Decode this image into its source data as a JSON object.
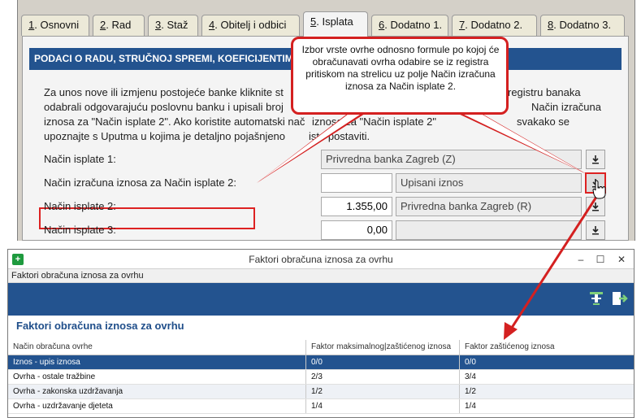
{
  "form": {
    "tabs": [
      {
        "num": "1",
        "label": ". Osnovni"
      },
      {
        "num": "2",
        "label": ". Rad"
      },
      {
        "num": "3",
        "label": ". Staž"
      },
      {
        "num": "4",
        "label": ". Obitelj i odbici"
      },
      {
        "num": "5",
        "label": ". Isplata"
      },
      {
        "num": "6",
        "label": ". Dodatno 1."
      },
      {
        "num": "7",
        "label": ". Dodatno 2."
      },
      {
        "num": "8",
        "label": ". Dodatno 3."
      }
    ],
    "active_tab": "5. Isplata",
    "section_header": "PODACI O RADU, STRUČNOJ SPREMI, KOEFICIJENTIMA, IS",
    "intro_lines": [
      "Za unos nove ili izmjenu postojeće banke kliknite st",
      "odabrali odgovarajuću poslovnu banku i upisali broj",
      "iznosa za \"Način isplate 2\". Ako koristite automatski nač",
      "upoznajte s Uputma u kojima je detaljno pojašnjeno",
      "registru banaka",
      "Način izračuna",
      "iznosa za \"Način isplate 2\"",
      "svakako se",
      "isto postaviti."
    ],
    "rows": [
      {
        "label": "Način isplate 1:",
        "amount": "",
        "bank": "Privredna banka Zagreb (Z)"
      },
      {
        "label": "Način izračuna iznosa za Način isplate 2:",
        "amount": "",
        "bank": "Upisani iznos"
      },
      {
        "label": "Način isplate 2:",
        "amount": "1.355,00",
        "bank": "Privredna banka Zagreb (R)"
      },
      {
        "label": "Način isplate 3:",
        "amount": "0,00",
        "bank": ""
      }
    ]
  },
  "callout": {
    "text": "Izbor vrste ovrhe odnosno formule po kojoj će obračunavati ovrha odabire se iz registra pritiskom na strelicu uz polje Način izračuna iznosa za Način isplate 2."
  },
  "dialog": {
    "title": "Faktori obračuna iznosa za ovrhu",
    "subtitle": "Faktori obračuna iznosa za ovrhu",
    "section_title": "Faktori obračuna iznosa za ovrhu",
    "window_controls": {
      "minimize": "–",
      "maximize": "☐",
      "close": "✕"
    },
    "columns": [
      "Način obračuna ovrhe",
      "Faktor maksimalnog|zaštićenog iznosa",
      "Faktor zaštićenog iznosa"
    ],
    "rows": [
      [
        "Iznos - upis iznosa",
        "0/0",
        "0/0"
      ],
      [
        "Ovrha - ostale tražbine",
        "2/3",
        "3/4"
      ],
      [
        "Ovrha - zakonska uzdržavanja",
        "1/2",
        "1/2"
      ],
      [
        "Ovrha - uzdržavanje djeteta",
        "1/4",
        "1/4"
      ]
    ],
    "selected_row": 0,
    "toolbar_icons": [
      "filter-icon",
      "exit-icon"
    ],
    "colors": {
      "accent": "#23538f",
      "highlight": "#d42020",
      "app_icon": "#1e9a3e"
    }
  }
}
